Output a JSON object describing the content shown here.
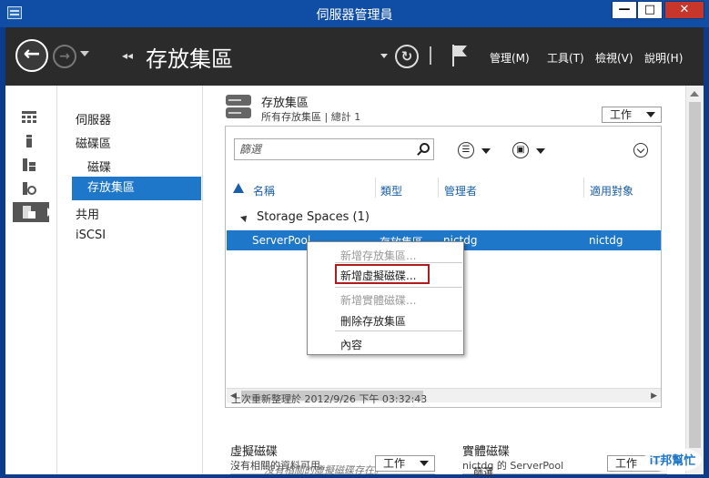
{
  "window": {
    "title": "伺服器管理員"
  },
  "header": {
    "page_title": "存放集區",
    "menus": {
      "manage": "管理(M)",
      "tools": "工具(T)",
      "view": "檢視(V)",
      "help": "說明(H)"
    }
  },
  "nav": {
    "items": [
      "伺服器",
      "磁碟區",
      "磁碟",
      "存放集區",
      "共用",
      "iSCSI"
    ]
  },
  "pools": {
    "title": "存放集區",
    "subtitle": "所有存放集區 | 總計 1",
    "tasks_label": "工作",
    "filter_placeholder": "篩選",
    "columns": {
      "name": "名稱",
      "type": "類型",
      "manager": "管理者",
      "applies_to": "適用對象"
    },
    "group_label": "Storage Spaces (1)",
    "row": {
      "name": "ServerPool",
      "type": "存放集區",
      "manager": "nictdg",
      "applies_to": "nictdg"
    },
    "status": "上次重新整理於 2012/9/26 下午 03:32:43"
  },
  "context_menu": {
    "new_pool": "新增存放集區...",
    "new_vdisk": "新增虛擬磁碟...",
    "new_pdisk": "新增實體磁碟...",
    "delete_pool": "刪除存放集區",
    "properties": "內容"
  },
  "vdisk": {
    "title": "虛擬磁碟",
    "subtitle": "沒有相關的資料可用。",
    "tasks_label": "工作",
    "empty": "沒有相關的虛擬磁碟存在。"
  },
  "pdisk": {
    "title": "實體磁碟",
    "subtitle": "nictdg 的 ServerPool",
    "tasks_label": "工作",
    "filter_placeholder": "篩選"
  },
  "watermark": {
    "text": "iT邦幫忙"
  },
  "colors": {
    "accent": "#1e77c9",
    "header_bg": "#2b2b2b",
    "title_bar": "#0f4ea4",
    "highlight_border": "#b01c1c"
  }
}
